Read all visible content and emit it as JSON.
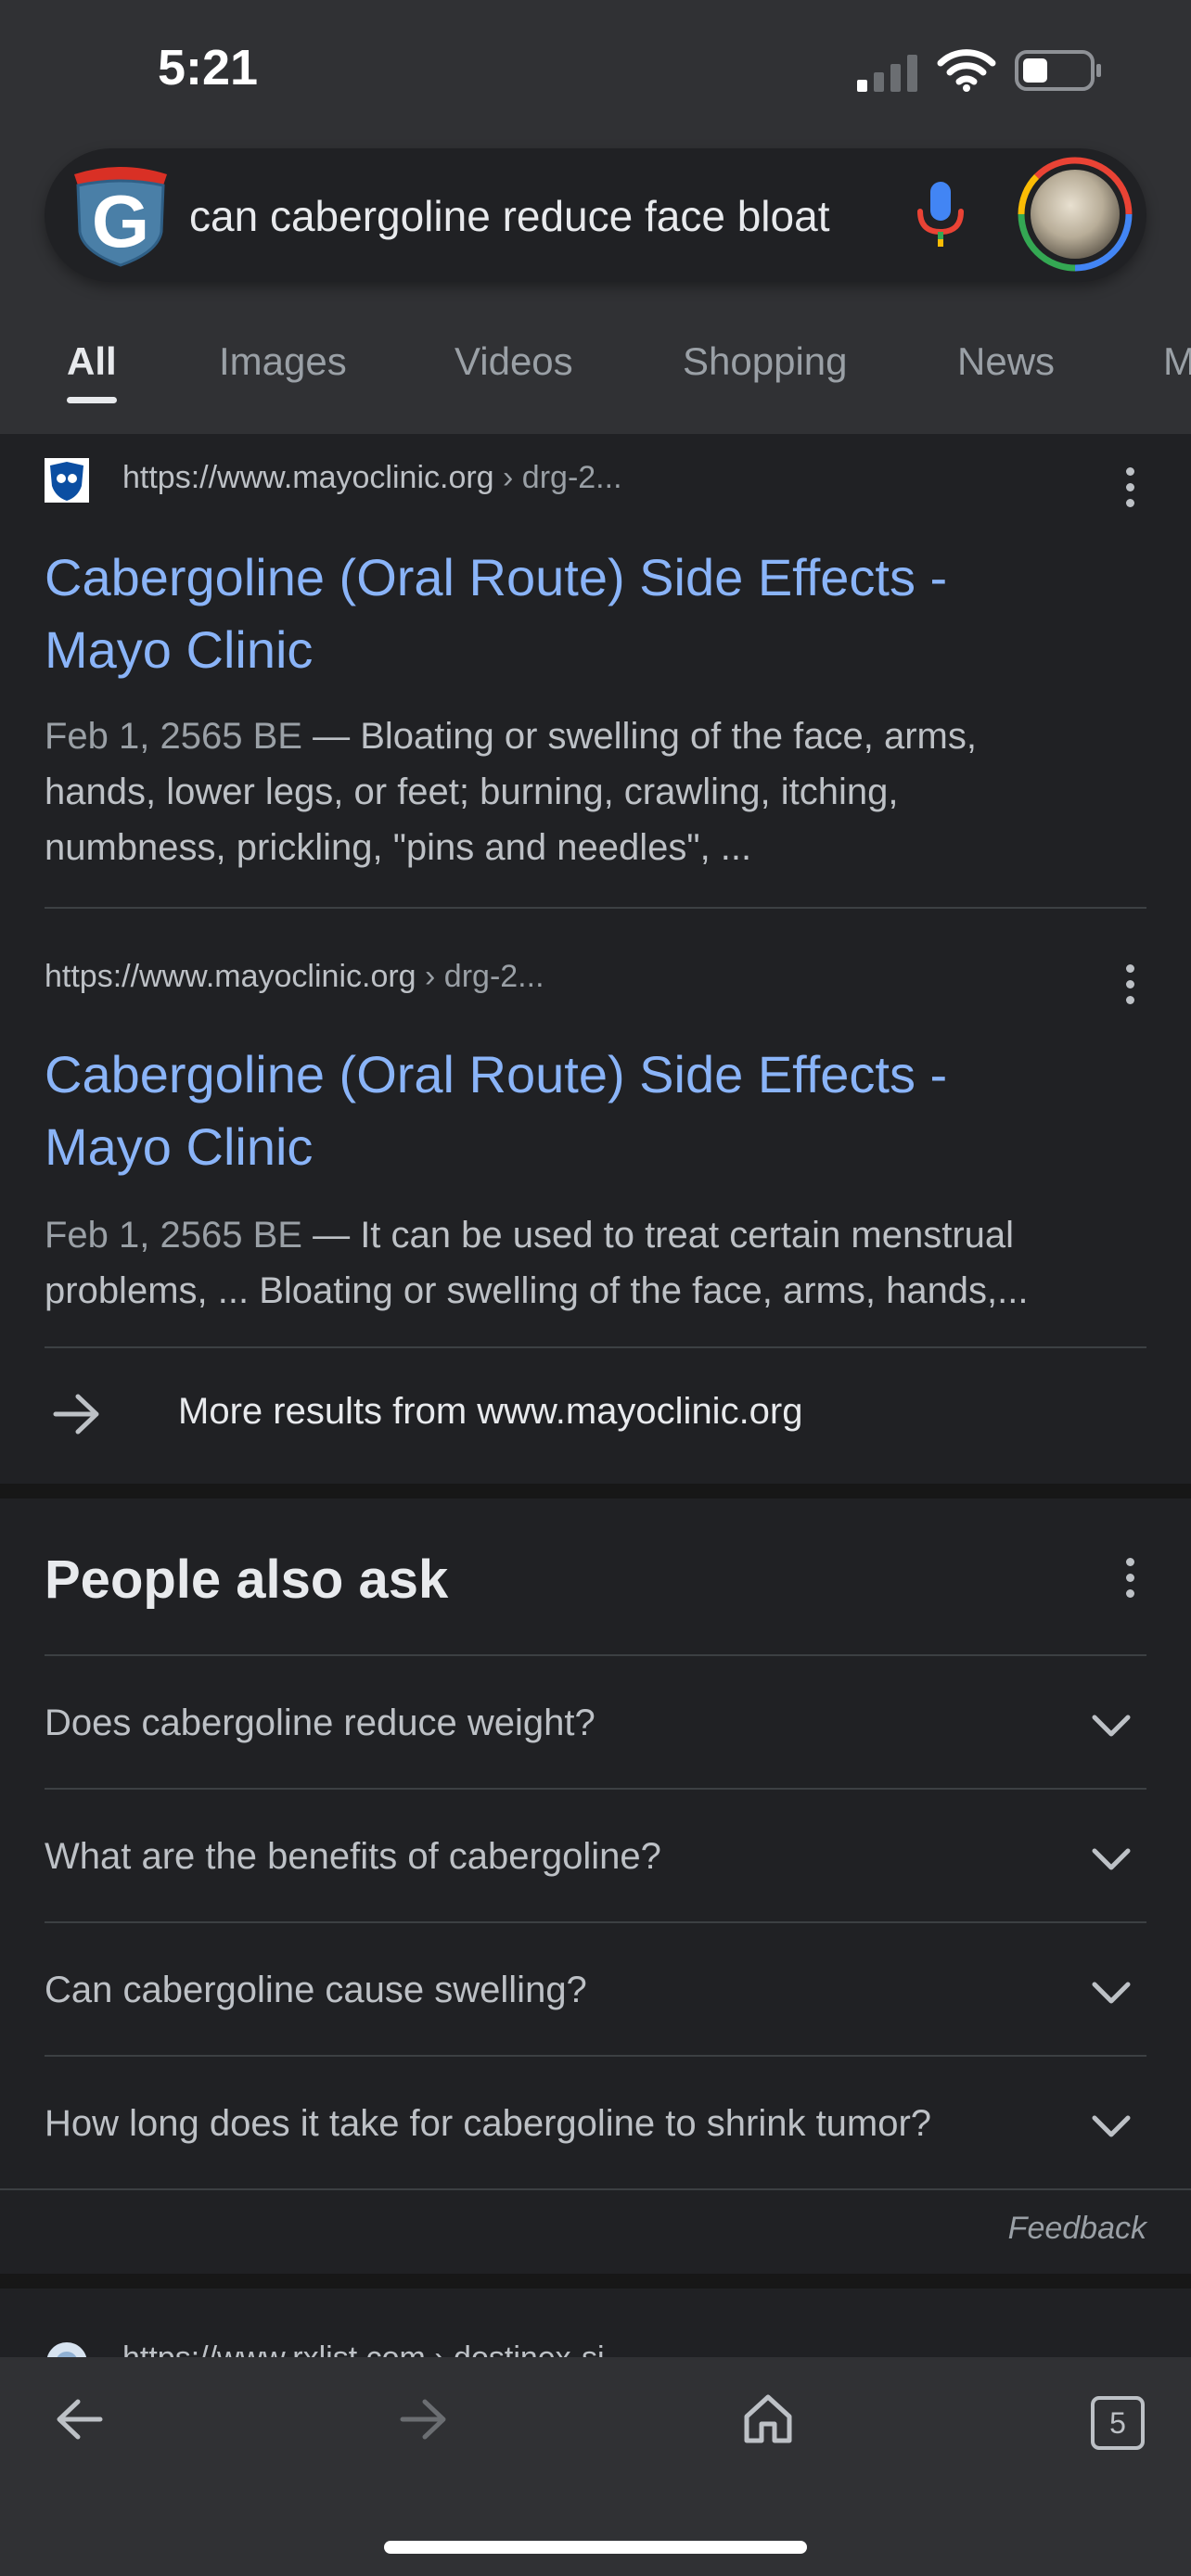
{
  "status": {
    "time": "5:21"
  },
  "search": {
    "query": "can cabergoline reduce face bloat"
  },
  "tabs": [
    "All",
    "Images",
    "Videos",
    "Shopping",
    "News",
    "M"
  ],
  "results": [
    {
      "url_domain": "https://www.mayoclinic.org",
      "url_path": " › drg-2...",
      "title_line1": "Cabergoline (Oral Route) Side Effects -",
      "title_line2": "Mayo Clinic",
      "date": "Feb 1, 2565 BE",
      "snippet_line1": " — Bloating or swelling of the face, arms,",
      "snippet_line2": "hands, lower legs, or feet; burning, crawling, itching,",
      "snippet_line3": "numbness, prickling, \"pins and needles\", ..."
    },
    {
      "url_domain": "https://www.mayoclinic.org",
      "url_path": " › drg-2...",
      "title_line1": "Cabergoline (Oral Route) Side Effects -",
      "title_line2": "Mayo Clinic",
      "date": "Feb 1, 2565 BE",
      "snippet_line1": " — It can be used to treat certain menstrual",
      "snippet_line2": "problems, ... Bloating or swelling of the face, arms, hands,..."
    }
  ],
  "more_results": "More results from www.mayoclinic.org",
  "people_also_ask": {
    "title": "People also ask",
    "questions": [
      "Does cabergoline reduce weight?",
      "What are the benefits of cabergoline?",
      "Can cabergoline cause swelling?",
      "How long does it take for cabergoline to shrink tumor?"
    ]
  },
  "feedback": "Feedback",
  "next_result": {
    "url": "https://www.rxlist.com › dostinex-si..."
  },
  "bottom_bar": {
    "tab_count": "5"
  },
  "colors": {
    "link": "#8ab4f8",
    "background": "#202124",
    "header": "#303134"
  }
}
